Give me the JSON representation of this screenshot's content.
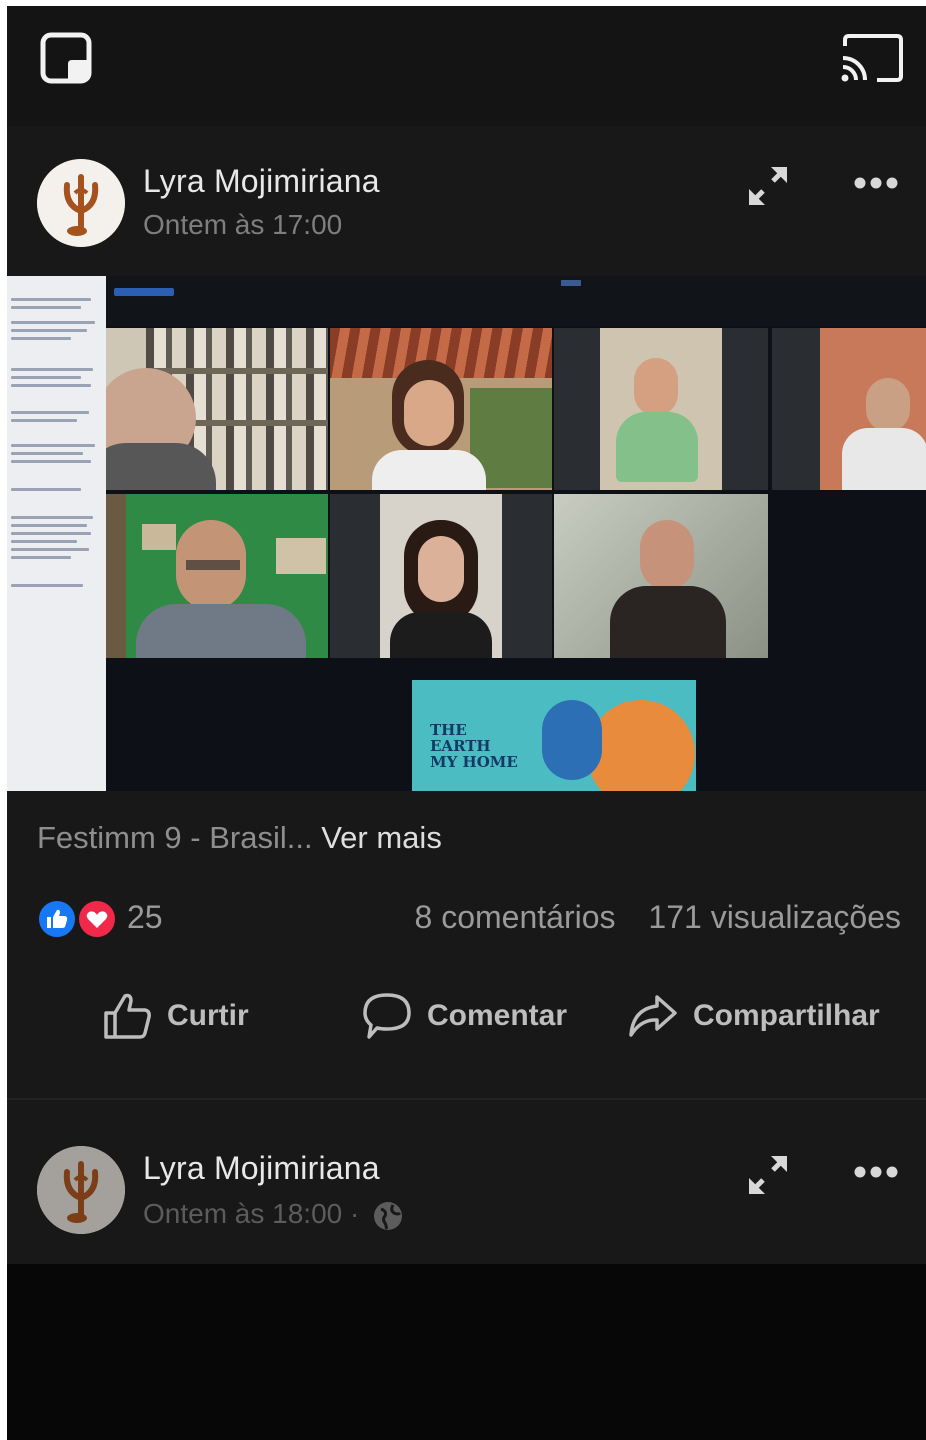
{
  "top_bar": {
    "pip_icon": "picture-in-picture-icon",
    "cast_icon": "cast-icon"
  },
  "posts": [
    {
      "author": "Lyra Mojimiriana",
      "time": "Ontem às 17:00"
    },
    {
      "author": "Lyra Mojimiriana",
      "time": "Ontem às 18:00 ·"
    }
  ],
  "video": {
    "banner_text": "THE EARTH MY HOME"
  },
  "caption": {
    "text": "Festimm 9 - Brasil...",
    "see_more": "Ver mais"
  },
  "reactions": {
    "icons": [
      "like-icon",
      "love-icon"
    ],
    "count": "25",
    "comments": "8 comentários",
    "views": "171 visualizações"
  },
  "actions": {
    "like": "Curtir",
    "comment": "Comentar",
    "share": "Compartilhar"
  },
  "colors": {
    "like_blue": "#1877f2",
    "love_red": "#f0284a",
    "background": "#181818"
  }
}
